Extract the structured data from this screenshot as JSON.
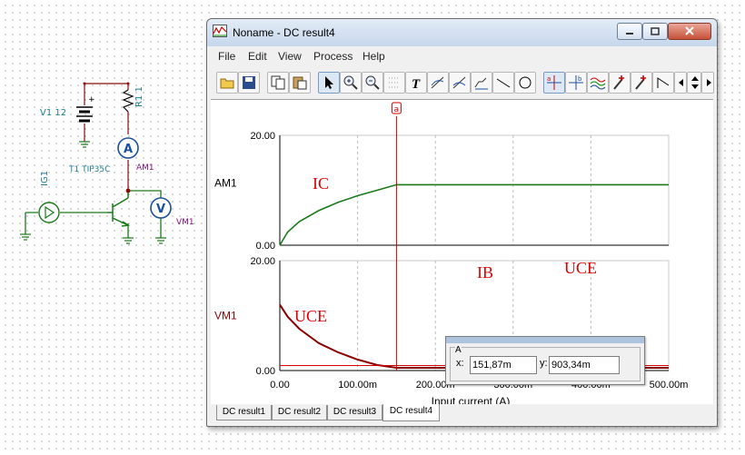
{
  "window": {
    "title": "Noname - DC result4",
    "controls": [
      "minimize",
      "restore",
      "close"
    ]
  },
  "menu": [
    "File",
    "Edit",
    "View",
    "Process",
    "Help"
  ],
  "toolbar": {
    "icons": [
      "open-icon",
      "save-icon",
      "copy-icon",
      "paste-icon",
      "pointer-icon",
      "zoom-in-icon",
      "zoom-out-icon",
      "grid-icon",
      "text-icon",
      "cursor-a-icon",
      "cursor-b-icon",
      "curve-icon",
      "line-icon",
      "circle-icon",
      "cursor-ab-icon",
      "cursor-ba-icon",
      "wave-icon",
      "probe-icon",
      "probe2-icon",
      "step-icon",
      "arrow-left-icon",
      "arrow-updown-icon",
      "arrow-right-icon"
    ]
  },
  "tabs": [
    "DC result1",
    "DC result2",
    "DC result3",
    "DC result4"
  ],
  "selected_tab": "DC result4",
  "schematic": {
    "labels": [
      "V1 12",
      "R1 1",
      "T1 TIP35C",
      "AM1",
      "IG1",
      "VM1"
    ]
  },
  "cursor": {
    "marker": "a",
    "x_label": "x:",
    "y_label": "y:",
    "group": "A",
    "x_value": "151,87m",
    "y_value": "903,34m"
  },
  "annotations": {
    "ic": "IC",
    "uce_top": "UCE",
    "ib_top": "IB",
    "uce_left": "UCE",
    "ib_bottom": "IB"
  },
  "chart_data": [
    {
      "type": "line",
      "title": "",
      "series": [
        {
          "name": "AM1",
          "x": [
            0,
            0.01,
            0.025,
            0.05,
            0.075,
            0.1,
            0.125,
            0.15,
            0.2,
            0.3,
            0.4,
            0.5
          ],
          "values": [
            0,
            2.4,
            4.3,
            6.3,
            7.8,
            9.0,
            10.0,
            11.0,
            11.0,
            11.0,
            11.0,
            11.0
          ]
        }
      ],
      "xlim": [
        0,
        0.5
      ],
      "ylim": [
        0,
        20
      ],
      "ytick_labels": [
        "0.00",
        "20.00"
      ],
      "ylabel": "AM1",
      "grid": true,
      "color": "#1a7a1a"
    },
    {
      "type": "line",
      "title": "",
      "series": [
        {
          "name": "VM1",
          "x": [
            0,
            0.01,
            0.025,
            0.05,
            0.075,
            0.1,
            0.125,
            0.15,
            0.2,
            0.3,
            0.4,
            0.5
          ],
          "values": [
            12.0,
            9.8,
            7.6,
            5.0,
            3.3,
            2.0,
            1.0,
            0.5,
            0.5,
            0.5,
            0.5,
            0.5
          ]
        }
      ],
      "xlim": [
        0,
        0.5
      ],
      "ylim": [
        0,
        20
      ],
      "ytick_labels": [
        "0.00",
        "20.00"
      ],
      "ylabel": "VM1",
      "xtick_labels": [
        "0.00",
        "100.00m",
        "200.00m",
        "300.00m",
        "400.00m",
        "500.00m"
      ],
      "xlabel": "Input current (A)",
      "grid": true,
      "color": "#8b0000"
    }
  ]
}
